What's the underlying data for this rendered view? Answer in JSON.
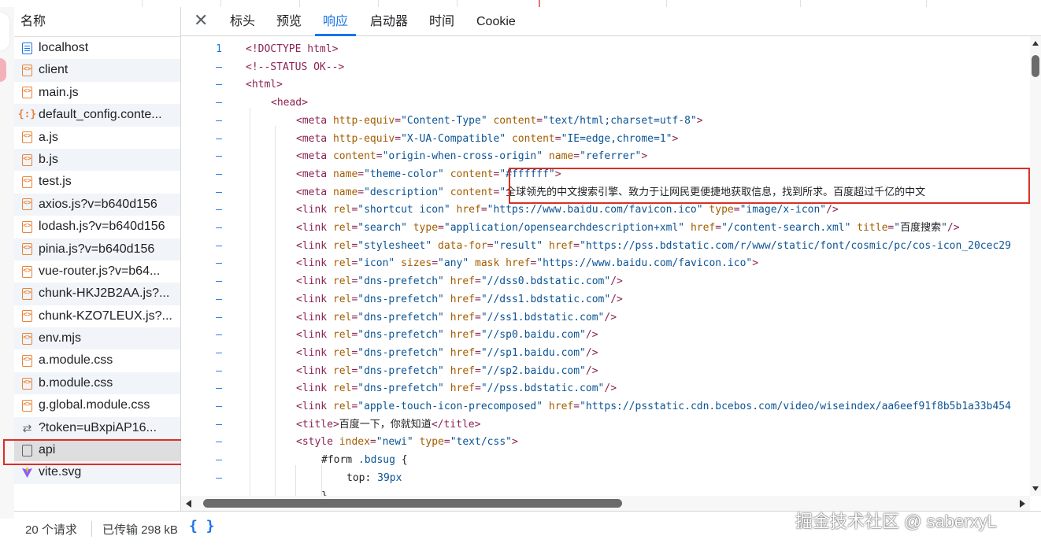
{
  "sidebar": {
    "header": "名称",
    "items": [
      {
        "label": "localhost",
        "icon": "document-icon"
      },
      {
        "label": "client",
        "icon": "script-icon"
      },
      {
        "label": "main.js",
        "icon": "script-icon"
      },
      {
        "label": "default_config.conte...",
        "icon": "json-icon"
      },
      {
        "label": "a.js",
        "icon": "script-icon"
      },
      {
        "label": "b.js",
        "icon": "script-icon"
      },
      {
        "label": "test.js",
        "icon": "script-icon"
      },
      {
        "label": "axios.js?v=b640d156",
        "icon": "script-icon"
      },
      {
        "label": "lodash.js?v=b640d156",
        "icon": "script-icon"
      },
      {
        "label": "pinia.js?v=b640d156",
        "icon": "script-icon"
      },
      {
        "label": "vue-router.js?v=b64...",
        "icon": "script-icon"
      },
      {
        "label": "chunk-HKJ2B2AA.js?...",
        "icon": "script-icon"
      },
      {
        "label": "chunk-KZO7LEUX.js?...",
        "icon": "script-icon"
      },
      {
        "label": "env.mjs",
        "icon": "script-icon"
      },
      {
        "label": "a.module.css",
        "icon": "script-icon"
      },
      {
        "label": "b.module.css",
        "icon": "script-icon"
      },
      {
        "label": "g.global.module.css",
        "icon": "script-icon"
      },
      {
        "label": "?token=uBxpiAP16...",
        "icon": "websocket-icon"
      },
      {
        "label": "api",
        "icon": "page-icon"
      },
      {
        "label": "vite.svg",
        "icon": "vite-icon"
      }
    ]
  },
  "footer": {
    "requests": "20 个请求",
    "transferred": "已传输 298 kB",
    "format_button": "{ }"
  },
  "tabs": [
    "标头",
    "预览",
    "响应",
    "启动器",
    "时间",
    "Cookie"
  ],
  "active_tab": "响应",
  "code_lines": [
    {
      "num": "1",
      "indent": 0,
      "parts": [
        [
          "t-com",
          "<!DOCTYPE html>"
        ]
      ]
    },
    {
      "num": "–",
      "indent": 0,
      "parts": [
        [
          "t-com",
          "<!--STATUS OK-->"
        ]
      ]
    },
    {
      "num": "–",
      "indent": 0,
      "parts": [
        [
          "t-tag",
          "<html>"
        ]
      ]
    },
    {
      "num": "–",
      "indent": 1,
      "parts": [
        [
          "t-tag",
          "<head>"
        ]
      ]
    },
    {
      "num": "–",
      "indent": 2,
      "parts": [
        [
          "t-tag",
          "<meta "
        ],
        [
          "t-attr",
          "http-equiv"
        ],
        [
          "t-tag",
          "="
        ],
        [
          "t-val",
          "\"Content-Type\" "
        ],
        [
          "t-attr",
          "content"
        ],
        [
          "t-tag",
          "="
        ],
        [
          "t-val",
          "\"text/html;charset=utf-8\""
        ],
        [
          "t-tag",
          ">"
        ]
      ]
    },
    {
      "num": "–",
      "indent": 2,
      "parts": [
        [
          "t-tag",
          "<meta "
        ],
        [
          "t-attr",
          "http-equiv"
        ],
        [
          "t-tag",
          "="
        ],
        [
          "t-val",
          "\"X-UA-Compatible\" "
        ],
        [
          "t-attr",
          "content"
        ],
        [
          "t-tag",
          "="
        ],
        [
          "t-val",
          "\"IE=edge,chrome=1\""
        ],
        [
          "t-tag",
          ">"
        ]
      ]
    },
    {
      "num": "–",
      "indent": 2,
      "parts": [
        [
          "t-tag",
          "<meta "
        ],
        [
          "t-attr",
          "content"
        ],
        [
          "t-tag",
          "="
        ],
        [
          "t-val",
          "\"origin-when-cross-origin\" "
        ],
        [
          "t-attr",
          "name"
        ],
        [
          "t-tag",
          "="
        ],
        [
          "t-val",
          "\"referrer\""
        ],
        [
          "t-tag",
          ">"
        ]
      ]
    },
    {
      "num": "–",
      "indent": 2,
      "parts": [
        [
          "t-tag",
          "<meta "
        ],
        [
          "t-attr",
          "name"
        ],
        [
          "t-tag",
          "="
        ],
        [
          "t-val",
          "\"theme-color\" "
        ],
        [
          "t-attr",
          "content"
        ],
        [
          "t-tag",
          "="
        ],
        [
          "t-val",
          "\"#ffffff\""
        ],
        [
          "t-tag",
          ">"
        ]
      ]
    },
    {
      "num": "–",
      "indent": 2,
      "parts": [
        [
          "t-tag",
          "<meta "
        ],
        [
          "t-attr",
          "name"
        ],
        [
          "t-tag",
          "="
        ],
        [
          "t-val",
          "\"description\" "
        ],
        [
          "t-attr",
          "content"
        ],
        [
          "t-tag",
          "="
        ],
        [
          "t-val",
          "\""
        ],
        [
          "t-text",
          "全球领先的中文搜索引擎、致力于让网民更便捷地获取信息，找到所求。百度超过千亿的中文"
        ]
      ]
    },
    {
      "num": "–",
      "indent": 2,
      "parts": [
        [
          "t-tag",
          "<link "
        ],
        [
          "t-attr",
          "rel"
        ],
        [
          "t-tag",
          "="
        ],
        [
          "t-val",
          "\"shortcut icon\" "
        ],
        [
          "t-attr",
          "href"
        ],
        [
          "t-tag",
          "="
        ],
        [
          "t-val",
          "\"https://www.baidu.com/favicon.ico\" "
        ],
        [
          "t-attr",
          "type"
        ],
        [
          "t-tag",
          "="
        ],
        [
          "t-val",
          "\"image/x-icon\""
        ],
        [
          "t-tag",
          "/>"
        ]
      ]
    },
    {
      "num": "–",
      "indent": 2,
      "parts": [
        [
          "t-tag",
          "<link "
        ],
        [
          "t-attr",
          "rel"
        ],
        [
          "t-tag",
          "="
        ],
        [
          "t-val",
          "\"search\" "
        ],
        [
          "t-attr",
          "type"
        ],
        [
          "t-tag",
          "="
        ],
        [
          "t-val",
          "\"application/opensearchdescription+xml\" "
        ],
        [
          "t-attr",
          "href"
        ],
        [
          "t-tag",
          "="
        ],
        [
          "t-val",
          "\"/content-search.xml\" "
        ],
        [
          "t-attr",
          "title"
        ],
        [
          "t-tag",
          "="
        ],
        [
          "t-val",
          "\""
        ],
        [
          "t-text",
          "百度搜索"
        ],
        [
          "t-val",
          "\""
        ],
        [
          "t-tag",
          "/>"
        ]
      ]
    },
    {
      "num": "–",
      "indent": 2,
      "parts": [
        [
          "t-tag",
          "<link "
        ],
        [
          "t-attr",
          "rel"
        ],
        [
          "t-tag",
          "="
        ],
        [
          "t-val",
          "\"stylesheet\" "
        ],
        [
          "t-attr",
          "data-for"
        ],
        [
          "t-tag",
          "="
        ],
        [
          "t-val",
          "\"result\" "
        ],
        [
          "t-attr",
          "href"
        ],
        [
          "t-tag",
          "="
        ],
        [
          "t-val",
          "\"https://pss.bdstatic.com/r/www/static/font/cosmic/pc/cos-icon_20cec29"
        ]
      ]
    },
    {
      "num": "–",
      "indent": 2,
      "parts": [
        [
          "t-tag",
          "<link "
        ],
        [
          "t-attr",
          "rel"
        ],
        [
          "t-tag",
          "="
        ],
        [
          "t-val",
          "\"icon\" "
        ],
        [
          "t-attr",
          "sizes"
        ],
        [
          "t-tag",
          "="
        ],
        [
          "t-val",
          "\"any\" "
        ],
        [
          "t-attr",
          "mask href"
        ],
        [
          "t-tag",
          "="
        ],
        [
          "t-val",
          "\"https://www.baidu.com/favicon.ico\""
        ],
        [
          "t-tag",
          ">"
        ]
      ]
    },
    {
      "num": "–",
      "indent": 2,
      "parts": [
        [
          "t-tag",
          "<link "
        ],
        [
          "t-attr",
          "rel"
        ],
        [
          "t-tag",
          "="
        ],
        [
          "t-val",
          "\"dns-prefetch\" "
        ],
        [
          "t-attr",
          "href"
        ],
        [
          "t-tag",
          "="
        ],
        [
          "t-val",
          "\"//dss0.bdstatic.com\""
        ],
        [
          "t-tag",
          "/>"
        ]
      ]
    },
    {
      "num": "–",
      "indent": 2,
      "parts": [
        [
          "t-tag",
          "<link "
        ],
        [
          "t-attr",
          "rel"
        ],
        [
          "t-tag",
          "="
        ],
        [
          "t-val",
          "\"dns-prefetch\" "
        ],
        [
          "t-attr",
          "href"
        ],
        [
          "t-tag",
          "="
        ],
        [
          "t-val",
          "\"//dss1.bdstatic.com\""
        ],
        [
          "t-tag",
          "/>"
        ]
      ]
    },
    {
      "num": "–",
      "indent": 2,
      "parts": [
        [
          "t-tag",
          "<link "
        ],
        [
          "t-attr",
          "rel"
        ],
        [
          "t-tag",
          "="
        ],
        [
          "t-val",
          "\"dns-prefetch\" "
        ],
        [
          "t-attr",
          "href"
        ],
        [
          "t-tag",
          "="
        ],
        [
          "t-val",
          "\"//ss1.bdstatic.com\""
        ],
        [
          "t-tag",
          "/>"
        ]
      ]
    },
    {
      "num": "–",
      "indent": 2,
      "parts": [
        [
          "t-tag",
          "<link "
        ],
        [
          "t-attr",
          "rel"
        ],
        [
          "t-tag",
          "="
        ],
        [
          "t-val",
          "\"dns-prefetch\" "
        ],
        [
          "t-attr",
          "href"
        ],
        [
          "t-tag",
          "="
        ],
        [
          "t-val",
          "\"//sp0.baidu.com\""
        ],
        [
          "t-tag",
          "/>"
        ]
      ]
    },
    {
      "num": "–",
      "indent": 2,
      "parts": [
        [
          "t-tag",
          "<link "
        ],
        [
          "t-attr",
          "rel"
        ],
        [
          "t-tag",
          "="
        ],
        [
          "t-val",
          "\"dns-prefetch\" "
        ],
        [
          "t-attr",
          "href"
        ],
        [
          "t-tag",
          "="
        ],
        [
          "t-val",
          "\"//sp1.baidu.com\""
        ],
        [
          "t-tag",
          "/>"
        ]
      ]
    },
    {
      "num": "–",
      "indent": 2,
      "parts": [
        [
          "t-tag",
          "<link "
        ],
        [
          "t-attr",
          "rel"
        ],
        [
          "t-tag",
          "="
        ],
        [
          "t-val",
          "\"dns-prefetch\" "
        ],
        [
          "t-attr",
          "href"
        ],
        [
          "t-tag",
          "="
        ],
        [
          "t-val",
          "\"//sp2.baidu.com\""
        ],
        [
          "t-tag",
          "/>"
        ]
      ]
    },
    {
      "num": "–",
      "indent": 2,
      "parts": [
        [
          "t-tag",
          "<link "
        ],
        [
          "t-attr",
          "rel"
        ],
        [
          "t-tag",
          "="
        ],
        [
          "t-val",
          "\"dns-prefetch\" "
        ],
        [
          "t-attr",
          "href"
        ],
        [
          "t-tag",
          "="
        ],
        [
          "t-val",
          "\"//pss.bdstatic.com\""
        ],
        [
          "t-tag",
          "/>"
        ]
      ]
    },
    {
      "num": "–",
      "indent": 2,
      "parts": [
        [
          "t-tag",
          "<link "
        ],
        [
          "t-attr",
          "rel"
        ],
        [
          "t-tag",
          "="
        ],
        [
          "t-val",
          "\"apple-touch-icon-precomposed\" "
        ],
        [
          "t-attr",
          "href"
        ],
        [
          "t-tag",
          "="
        ],
        [
          "t-val",
          "\"https://psstatic.cdn.bcebos.com/video/wiseindex/aa6eef91f8b5b1a33b454"
        ]
      ]
    },
    {
      "num": "–",
      "indent": 2,
      "parts": [
        [
          "t-tag",
          "<title>"
        ],
        [
          "t-text",
          "百度一下，你就知道"
        ],
        [
          "t-tag",
          "</title>"
        ]
      ]
    },
    {
      "num": "–",
      "indent": 2,
      "parts": [
        [
          "t-tag",
          "<style "
        ],
        [
          "t-attr",
          "index"
        ],
        [
          "t-tag",
          "="
        ],
        [
          "t-val",
          "\"newi\" "
        ],
        [
          "t-attr",
          "type"
        ],
        [
          "t-tag",
          "="
        ],
        [
          "t-val",
          "\"text/css\""
        ],
        [
          "t-tag",
          ">"
        ]
      ]
    },
    {
      "num": "–",
      "indent": 3,
      "parts": [
        [
          "t-css",
          "#form "
        ],
        [
          "t-val",
          ".bdsug "
        ],
        [
          "t-css",
          "{"
        ]
      ]
    },
    {
      "num": "–",
      "indent": 4,
      "parts": [
        [
          "t-css",
          "top: "
        ],
        [
          "t-val",
          "39px"
        ]
      ]
    },
    {
      "num": "",
      "indent": 3,
      "parts": [
        [
          "t-css",
          "}"
        ]
      ]
    }
  ],
  "watermark": "掘金技术社区 @ saberxyL"
}
